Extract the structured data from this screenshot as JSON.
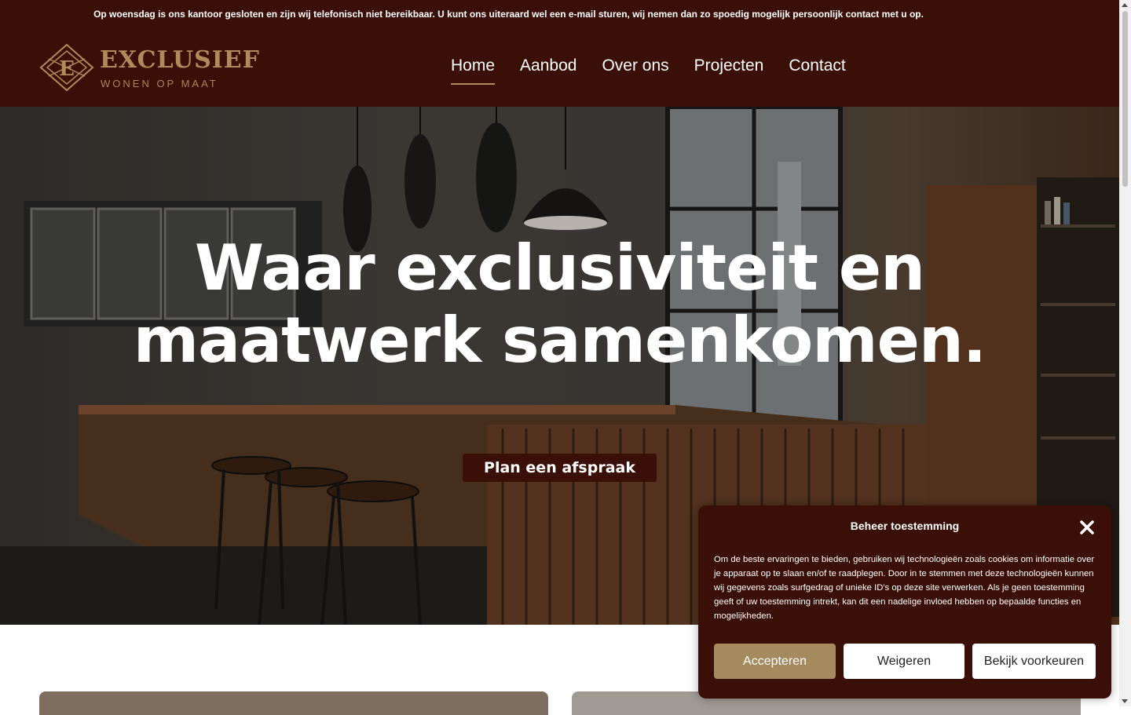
{
  "notice": "Op woensdag is ons kantoor gesloten en zijn wij telefonisch niet bereikbaar. U kunt ons uiteraard wel een e-mail sturen, wij nemen dan zo spoedig mogelijk persoonlijk contact met u op.",
  "logo": {
    "mark": "E",
    "name": "EXCLUSIEF",
    "tagline": "WONEN OP MAAT"
  },
  "nav": [
    {
      "label": "Home",
      "active": true
    },
    {
      "label": "Aanbod"
    },
    {
      "label": "Over ons"
    },
    {
      "label": "Projecten"
    },
    {
      "label": "Contact"
    }
  ],
  "hero": {
    "headline_line1": "Waar exclusiviteit en",
    "headline_line2": "maatwerk samenkomen.",
    "cta": "Plan een afspraak"
  },
  "consent": {
    "title": "Beheer toestemming",
    "text": "Om de beste ervaringen te bieden, gebruiken wij technologieën zoals cookies om informatie over je apparaat op te slaan en/of te raadplegen. Door in te stemmen met deze technologieën kunnen wij gegevens zoals surfgedrag of unieke ID's op deze site verwerken. Als je geen toestemming geeft of uw toestemming intrekt, kan dit een nadelige invloed hebben op bepaalde functies en mogelijkheden.",
    "accept": "Accepteren",
    "deny": "Weigeren",
    "preferences": "Bekijk voorkeuren"
  },
  "colors": {
    "brand_dark": "#3a0f07",
    "gold": "#b08a5a",
    "accept_button": "#a58a5e"
  }
}
